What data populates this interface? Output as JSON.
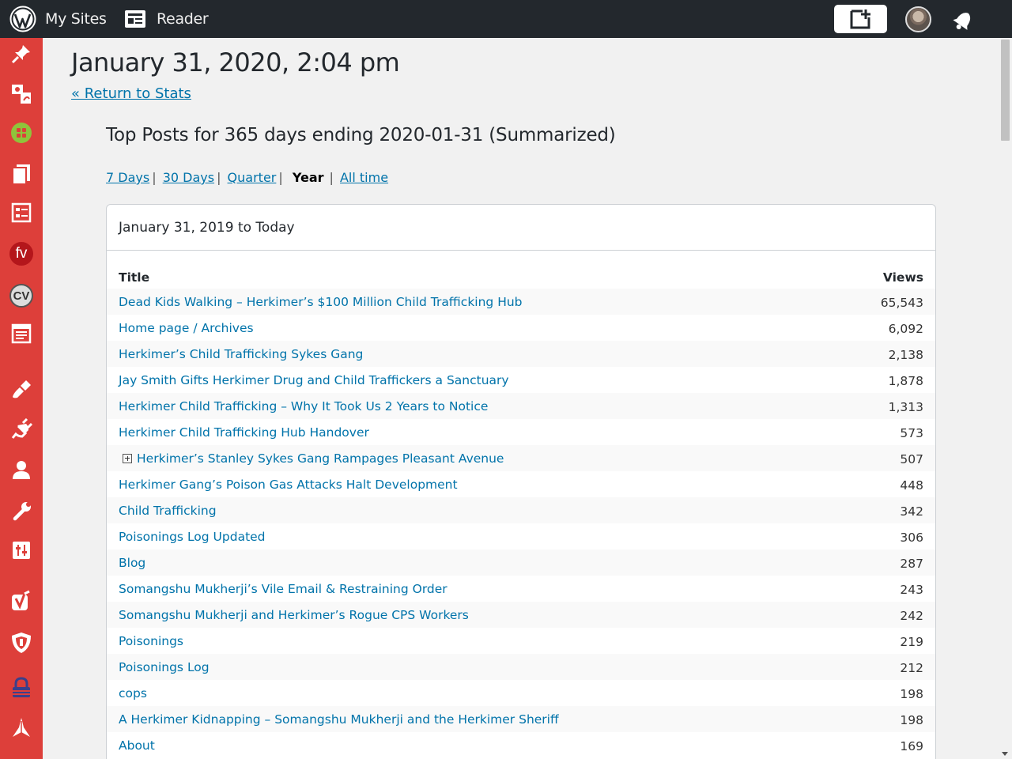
{
  "topbar": {
    "my_sites": "My Sites",
    "reader": "Reader",
    "accent": "#23282d"
  },
  "sidebar": {
    "background": "#dd3f3a",
    "icons": [
      "pin-icon",
      "media-icon",
      "grid-plugin-icon",
      "pages-icon",
      "forms-icon",
      "fv-icon",
      "cv-icon",
      "feedback-icon",
      "appearance-icon",
      "plugins-icon",
      "users-icon",
      "tools-icon",
      "settings-icon",
      "yoast-icon",
      "security-shield-icon",
      "lock-icon",
      "collapse-icon"
    ],
    "fv_label": "fv",
    "cv_label": "CV"
  },
  "page": {
    "date_heading": "January 31, 2020, 2:04 pm",
    "return_link": "« Return to Stats",
    "section_title": "Top Posts for 365 days ending 2020-01-31 (Summarized)"
  },
  "periods": {
    "days7": "7 Days",
    "days30": "30 Days",
    "quarter": "Quarter",
    "year": "Year",
    "all_time": "All time",
    "separator": "|"
  },
  "postbox": {
    "header": "January 31, 2019 to Today",
    "col_title": "Title",
    "col_views": "Views",
    "rows": [
      {
        "title": "Dead Kids Walking – Herkimer’s $100 Million Child Trafficking Hub",
        "views": "65,543"
      },
      {
        "title": "Home page / Archives",
        "views": "6,092"
      },
      {
        "title": "Herkimer’s Child Trafficking Sykes Gang",
        "views": "2,138"
      },
      {
        "title": "Jay Smith Gifts Herkimer Drug and Child Traffickers a Sanctuary",
        "views": "1,878"
      },
      {
        "title": "Herkimer Child Trafficking – Why It Took Us 2 Years to Notice",
        "views": "1,313"
      },
      {
        "title": "Herkimer Child Trafficking Hub Handover",
        "views": "573"
      },
      {
        "title": "Herkimer’s Stanley Sykes Gang Rampages Pleasant Avenue",
        "views": "507"
      },
      {
        "title": "Herkimer Gang’s Poison Gas Attacks Halt Development",
        "views": "448"
      },
      {
        "title": "Child Trafficking",
        "views": "342"
      },
      {
        "title": "Poisonings Log Updated",
        "views": "306"
      },
      {
        "title": "Blog",
        "views": "287"
      },
      {
        "title": "Somangshu Mukherji’s Vile Email & Restraining Order",
        "views": "243"
      },
      {
        "title": "Somangshu Mukherji and Herkimer’s Rogue CPS Workers",
        "views": "242"
      },
      {
        "title": "Poisonings",
        "views": "219"
      },
      {
        "title": "Poisonings Log",
        "views": "212"
      },
      {
        "title": "cops",
        "views": "198"
      },
      {
        "title": "A Herkimer Kidnapping – Somangshu Mukherji and the Herkimer Sheriff",
        "views": "198"
      },
      {
        "title": "About",
        "views": "169"
      }
    ]
  }
}
